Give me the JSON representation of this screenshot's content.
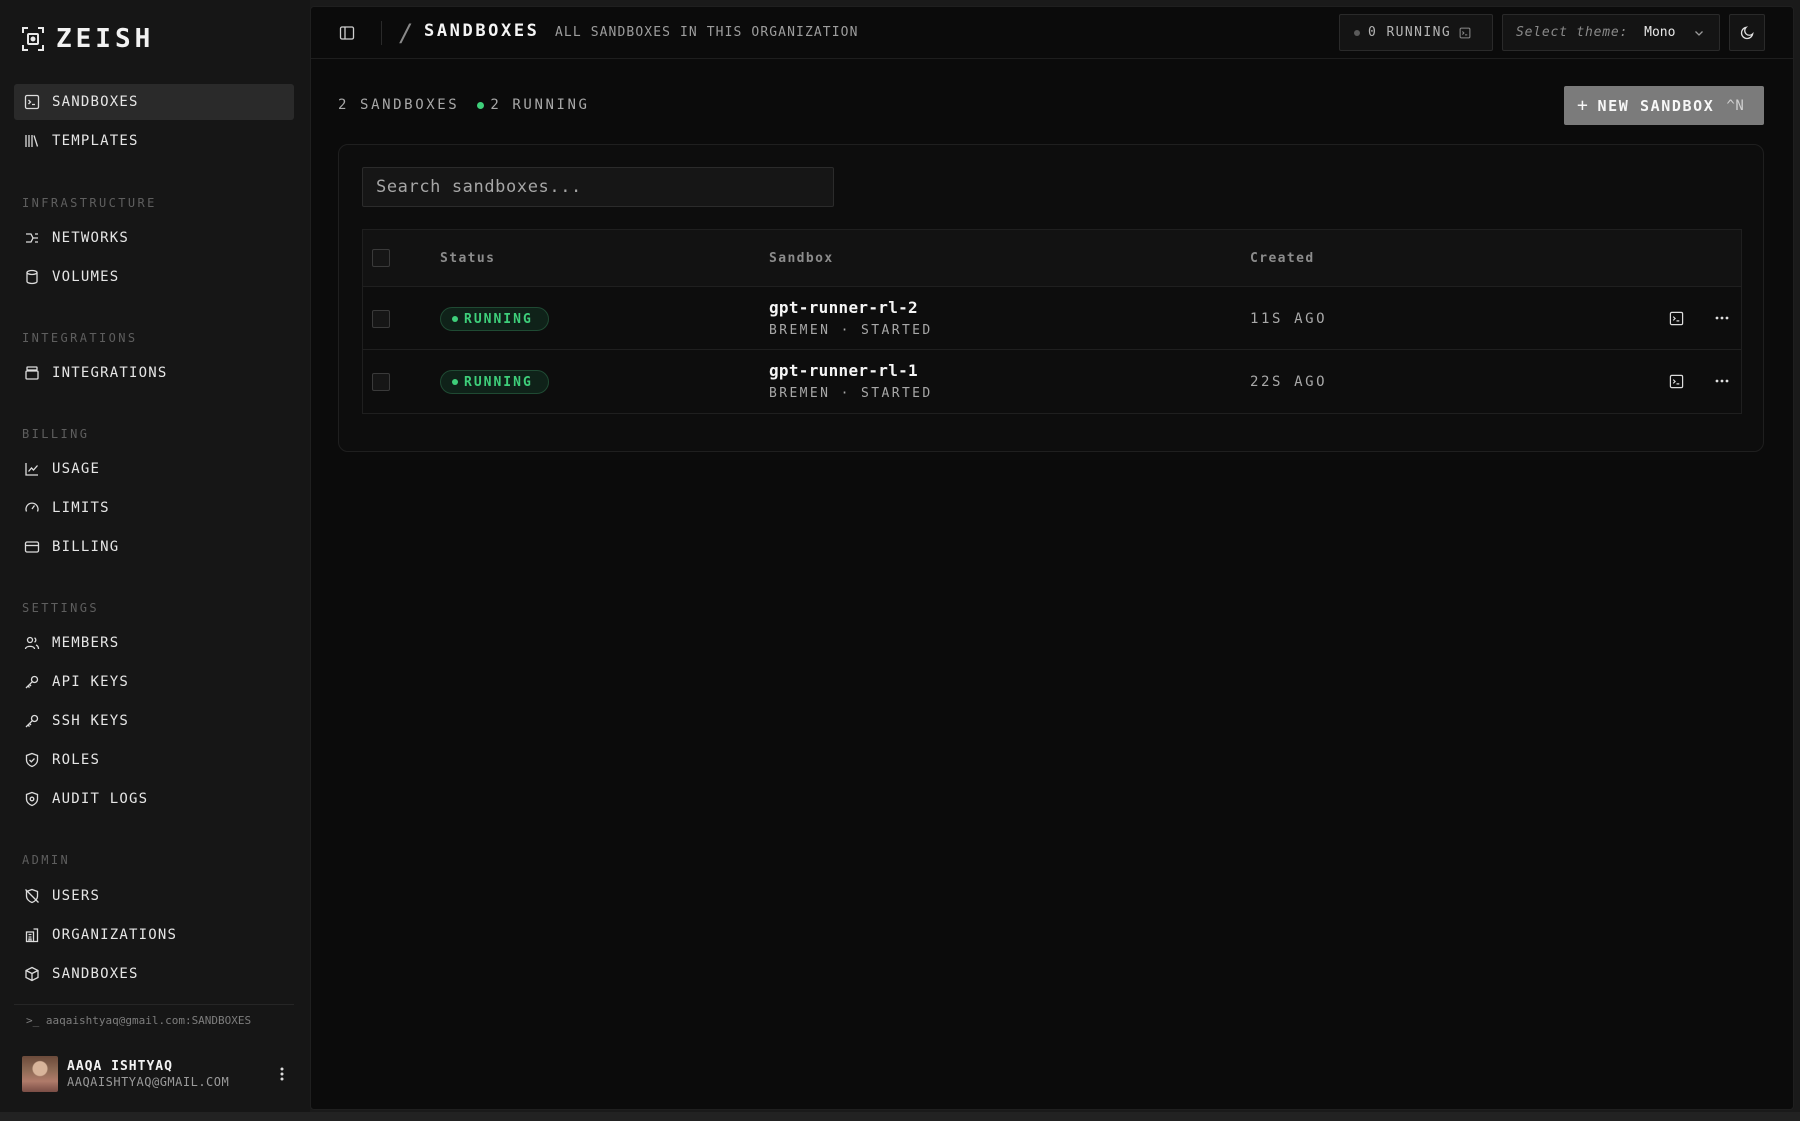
{
  "app": {
    "name": "ZEISH"
  },
  "sidebar": {
    "primary": [
      {
        "label": "SANDBOXES",
        "icon": "terminal-square-icon",
        "active": true
      },
      {
        "label": "TEMPLATES",
        "icon": "library-icon"
      }
    ],
    "sections": [
      {
        "title": "INFRASTRUCTURE",
        "items": [
          {
            "label": "NETWORKS",
            "icon": "network-icon"
          },
          {
            "label": "VOLUMES",
            "icon": "database-icon"
          }
        ]
      },
      {
        "title": "INTEGRATIONS",
        "items": [
          {
            "label": "INTEGRATIONS",
            "icon": "layers-icon"
          }
        ]
      },
      {
        "title": "BILLING",
        "items": [
          {
            "label": "USAGE",
            "icon": "chart-line-icon"
          },
          {
            "label": "LIMITS",
            "icon": "gauge-icon"
          },
          {
            "label": "BILLING",
            "icon": "credit-card-icon"
          }
        ]
      },
      {
        "title": "SETTINGS",
        "items": [
          {
            "label": "MEMBERS",
            "icon": "users-icon"
          },
          {
            "label": "API KEYS",
            "icon": "key-icon"
          },
          {
            "label": "SSH KEYS",
            "icon": "key-icon"
          },
          {
            "label": "ROLES",
            "icon": "shield-check-icon"
          },
          {
            "label": "AUDIT LOGS",
            "icon": "shield-icon"
          }
        ]
      },
      {
        "title": "ADMIN",
        "items": [
          {
            "label": "USERS",
            "icon": "shield-off-icon"
          },
          {
            "label": "ORGANIZATIONS",
            "icon": "building-icon"
          },
          {
            "label": "SANDBOXES",
            "icon": "box-icon"
          }
        ]
      }
    ],
    "cli_context": ">_ aaqaishtyaq@gmail.com:SANDBOXES",
    "user": {
      "name": "AAQA ISHTYAQ",
      "email": "AAQAISHTYAQ@GMAIL.COM"
    }
  },
  "topbar": {
    "slash": "/",
    "title": "SANDBOXES",
    "subtitle": "ALL SANDBOXES IN THIS ORGANIZATION",
    "running_indicator": "0 RUNNING",
    "theme_label": "Select theme:",
    "theme_value": "Mono"
  },
  "summary": {
    "count": "2 SANDBOXES",
    "running": "2 RUNNING"
  },
  "new_button": {
    "plus": "+",
    "label": "NEW SANDBOX",
    "shortcut": "^N"
  },
  "search": {
    "placeholder": "Search sandboxes..."
  },
  "table": {
    "headers": {
      "status": "Status",
      "sandbox": "Sandbox",
      "created": "Created"
    },
    "rows": [
      {
        "status": "RUNNING",
        "name": "gpt-runner-rl-2",
        "meta": "BREMEN · STARTED",
        "created": "11S AGO"
      },
      {
        "status": "RUNNING",
        "name": "gpt-runner-rl-1",
        "meta": "BREMEN · STARTED",
        "created": "22S AGO"
      }
    ]
  },
  "colors": {
    "accent_green": "#3ecf7a",
    "background": "#0b0b0b",
    "sidebar": "#161616",
    "button": "#7b7b7b"
  }
}
